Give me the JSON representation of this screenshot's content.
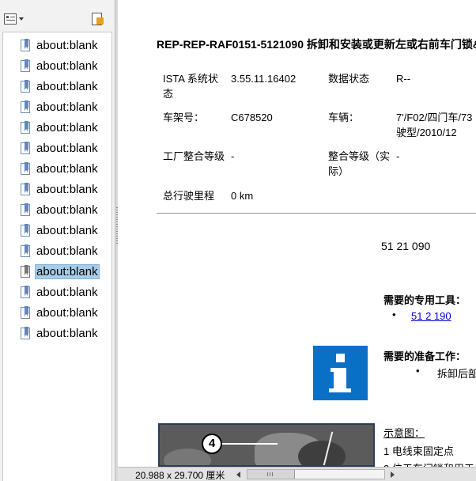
{
  "bookmarks": {
    "toolbar": {
      "options_icon": "options-menu-icon",
      "expand_icon": "expand-bookmark-icon"
    },
    "items": [
      {
        "label": "about:blank",
        "selected": false
      },
      {
        "label": "about:blank",
        "selected": false
      },
      {
        "label": "about:blank",
        "selected": false
      },
      {
        "label": "about:blank",
        "selected": false
      },
      {
        "label": "about:blank",
        "selected": false
      },
      {
        "label": "about:blank",
        "selected": false
      },
      {
        "label": "about:blank",
        "selected": false
      },
      {
        "label": "about:blank",
        "selected": false
      },
      {
        "label": "about:blank",
        "selected": false
      },
      {
        "label": "about:blank",
        "selected": false
      },
      {
        "label": "about:blank",
        "selected": false
      },
      {
        "label": "about:blank",
        "selected": true
      },
      {
        "label": "about:blank",
        "selected": false
      },
      {
        "label": "about:blank",
        "selected": false
      },
      {
        "label": "about:blank",
        "selected": false
      }
    ],
    "selection_color": "#a8cde8"
  },
  "document": {
    "title": "REP-REP-RAF0151-5121090   拆卸和安装或更新左或右前车门锁&",
    "fields": [
      {
        "label": "ISTA 系统状态",
        "value": "3.55.11.16402"
      },
      {
        "label": "数据状态",
        "value": "R--"
      },
      {
        "label": "车架号：",
        "value": "C678520"
      },
      {
        "label": "车辆：",
        "value": "7'/F02/四门车/73 驶型/2010/12"
      },
      {
        "label": "工厂整合等级",
        "value": "-"
      },
      {
        "label": "整合等级（实际）",
        "value": "-"
      },
      {
        "label": "总行驶里程",
        "value": "0 km"
      }
    ],
    "number": "51 21 090",
    "special_tools_heading": "需要的专用工具：",
    "special_tool_link": "51 2 190",
    "prep_work_heading": "需要的准备工作：",
    "prep_work_item": "拆卸后部",
    "info_icon": "info-icon",
    "info_color": "#0a70c6",
    "schematic_heading": "示意图：",
    "schematic_items": [
      "1  电线束固定点",
      "2  位于车门锁和用于"
    ],
    "callout_number": "4"
  },
  "statusbar": {
    "page_size": "20.988 x 29.700 厘米"
  }
}
